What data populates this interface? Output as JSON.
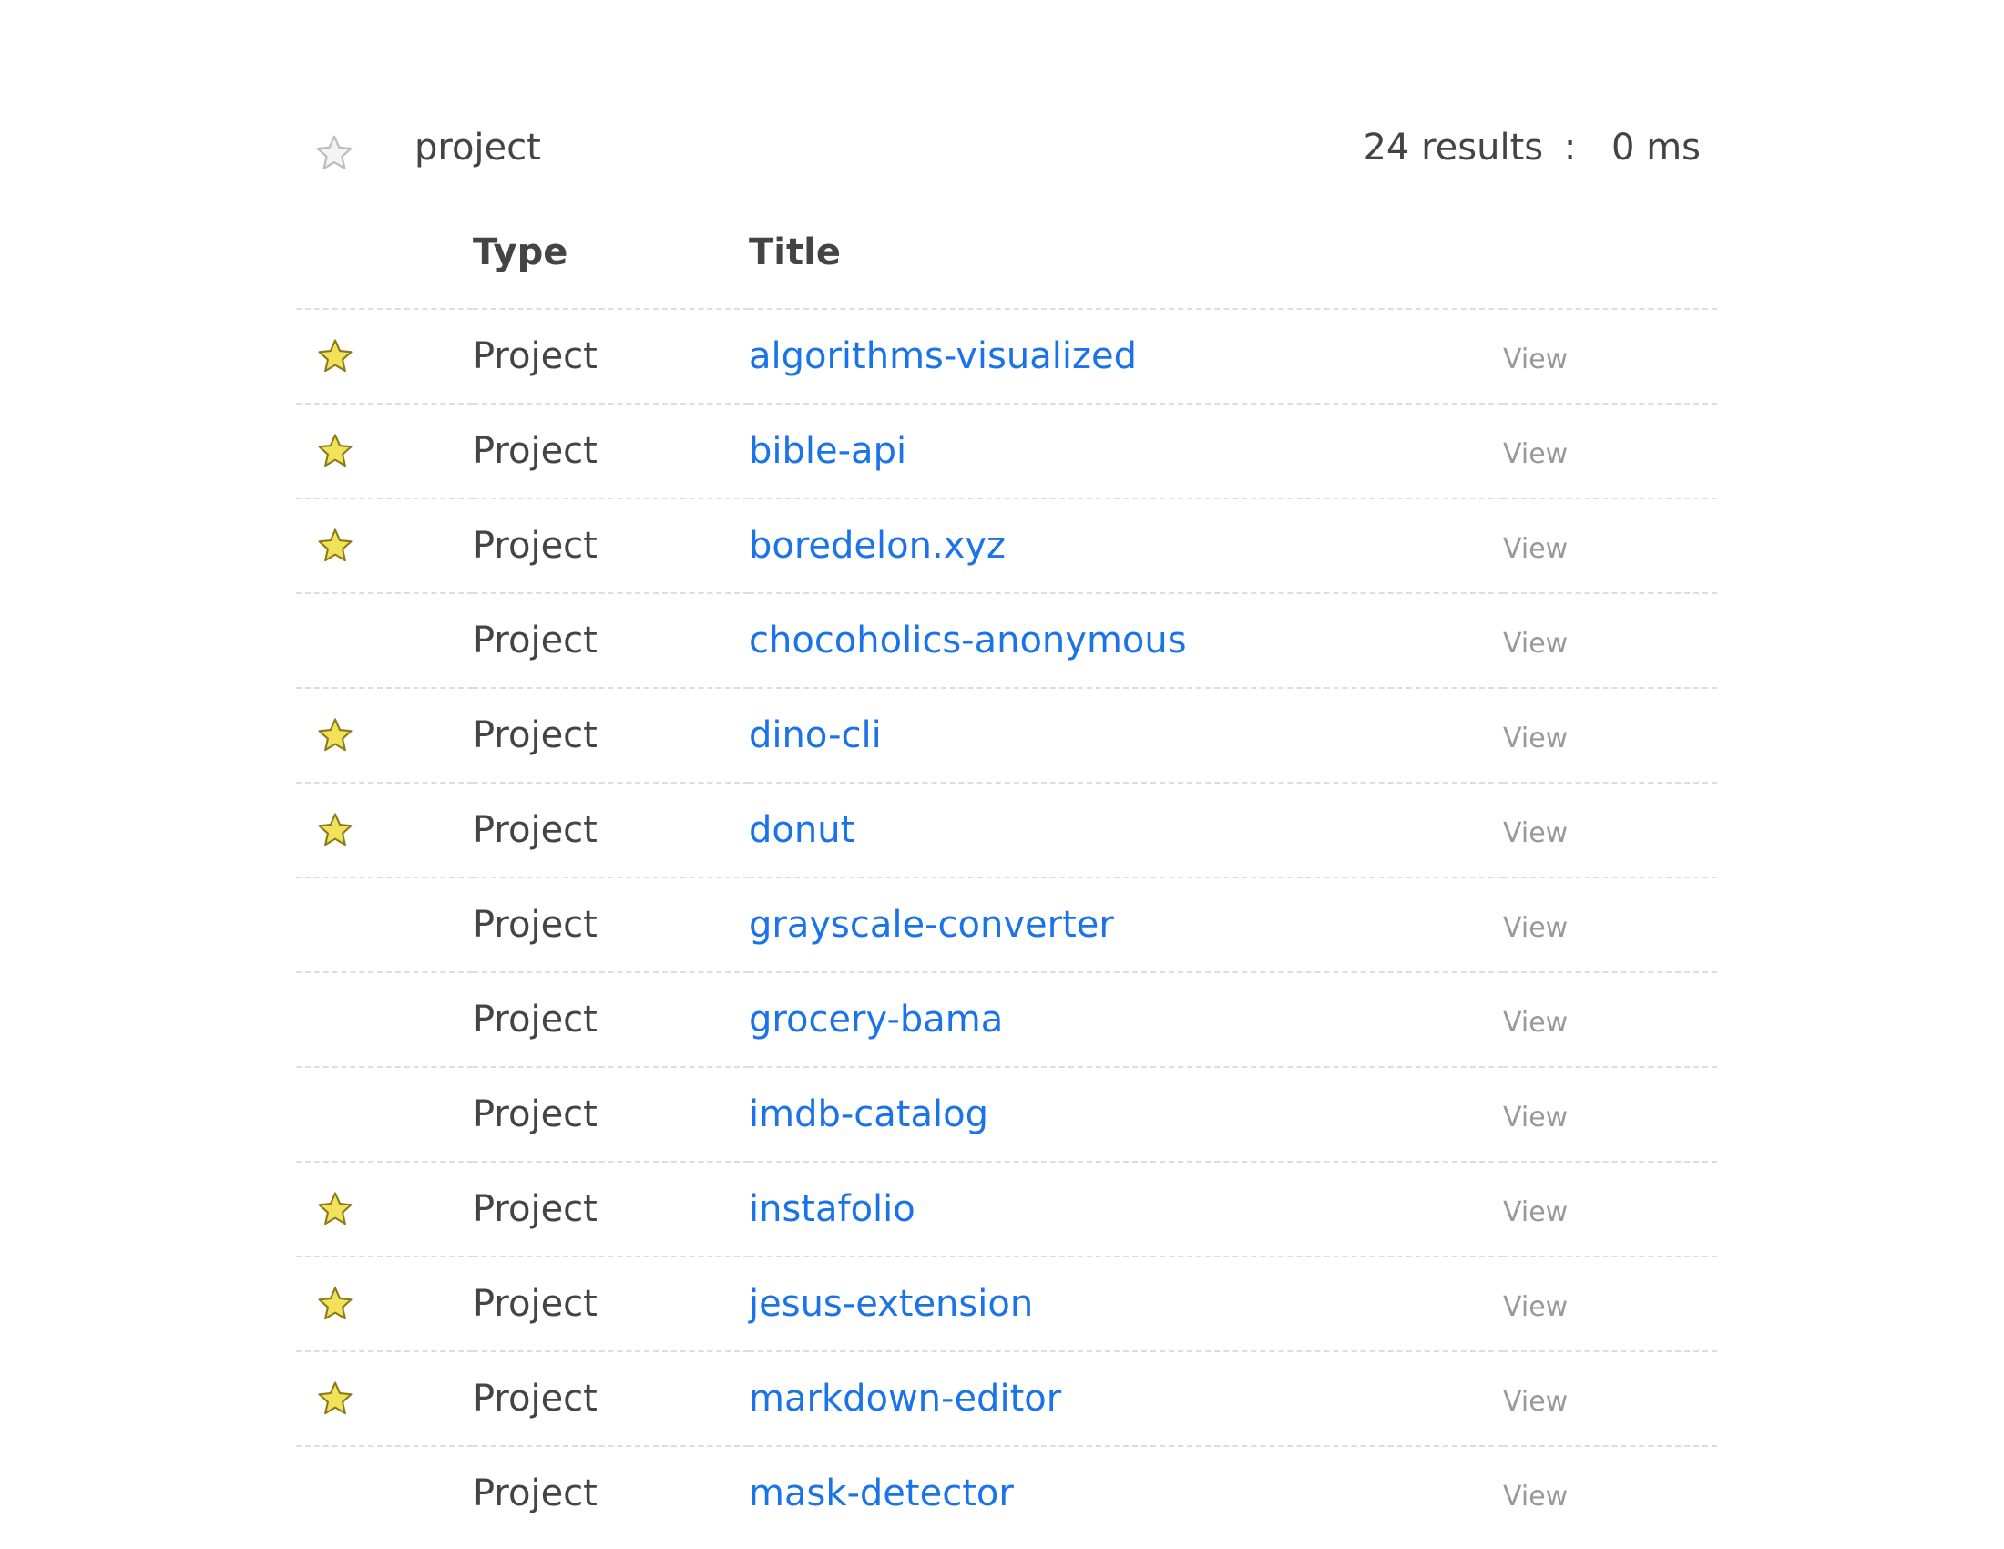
{
  "search": {
    "query": "project",
    "results_label": "24 results",
    "separator": ":",
    "time_label": "0 ms"
  },
  "table": {
    "headers": {
      "type": "Type",
      "title": "Title"
    },
    "rows": [
      {
        "starred": true,
        "type": "Project",
        "title": "algorithms-visualized",
        "action": "View"
      },
      {
        "starred": true,
        "type": "Project",
        "title": "bible-api",
        "action": "View"
      },
      {
        "starred": true,
        "type": "Project",
        "title": "boredelon.xyz",
        "action": "View"
      },
      {
        "starred": false,
        "type": "Project",
        "title": "chocoholics-anonymous",
        "action": "View"
      },
      {
        "starred": true,
        "type": "Project",
        "title": "dino-cli",
        "action": "View"
      },
      {
        "starred": true,
        "type": "Project",
        "title": "donut",
        "action": "View"
      },
      {
        "starred": false,
        "type": "Project",
        "title": "grayscale-converter",
        "action": "View"
      },
      {
        "starred": false,
        "type": "Project",
        "title": "grocery-bama",
        "action": "View"
      },
      {
        "starred": false,
        "type": "Project",
        "title": "imdb-catalog",
        "action": "View"
      },
      {
        "starred": true,
        "type": "Project",
        "title": "instafolio",
        "action": "View"
      },
      {
        "starred": true,
        "type": "Project",
        "title": "jesus-extension",
        "action": "View"
      },
      {
        "starred": true,
        "type": "Project",
        "title": "markdown-editor",
        "action": "View"
      },
      {
        "starred": false,
        "type": "Project",
        "title": "mask-detector",
        "action": "View"
      }
    ]
  },
  "colors": {
    "link": "#1a73e8",
    "star_fill": "#f2e25a",
    "star_stroke": "#8a7a1a",
    "empty_star_fill": "#f4f4f4",
    "empty_star_stroke": "#bbbbbb",
    "divider": "#dddddd",
    "view": "#999999"
  },
  "icons": {
    "starred": "star-filled-icon",
    "unstarred": "star-outline-icon"
  }
}
